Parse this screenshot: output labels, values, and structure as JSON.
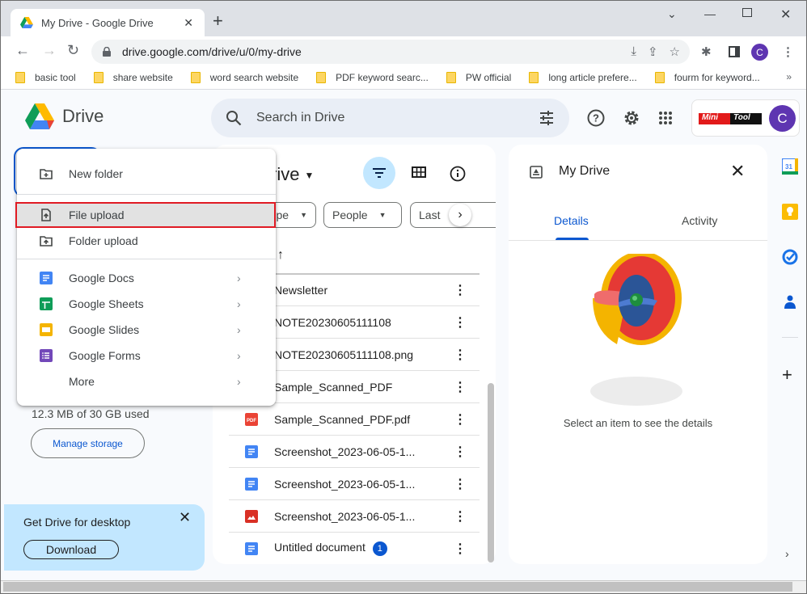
{
  "browser": {
    "tab_title": "My Drive - Google Drive",
    "url": "drive.google.com/drive/u/0/my-drive",
    "profile_initial": "C",
    "bookmarks": [
      {
        "label": "basic tool"
      },
      {
        "label": "share website"
      },
      {
        "label": "word search website"
      },
      {
        "label": "PDF keyword searc..."
      },
      {
        "label": "PW official"
      },
      {
        "label": "long article prefere..."
      },
      {
        "label": "fourm for keyword..."
      }
    ],
    "bookmarks_overflow": "»"
  },
  "header": {
    "app_name": "Drive",
    "search_placeholder": "Search in Drive",
    "account_brand_left": "Mini",
    "account_brand_right": "Tool",
    "account_initial": "C"
  },
  "new_menu": {
    "items": [
      {
        "label": "New folder",
        "icon": "new-folder-icon"
      },
      {
        "label": "File upload",
        "icon": "file-upload-icon",
        "highlighted": true
      },
      {
        "label": "Folder upload",
        "icon": "folder-upload-icon"
      },
      {
        "label": "Google Docs",
        "icon": "google-docs-icon",
        "submenu": true
      },
      {
        "label": "Google Sheets",
        "icon": "google-sheets-icon",
        "submenu": true
      },
      {
        "label": "Google Slides",
        "icon": "google-slides-icon",
        "submenu": true
      },
      {
        "label": "Google Forms",
        "icon": "google-forms-icon",
        "submenu": true
      },
      {
        "label": "More",
        "submenu": true
      }
    ],
    "chevron": "›"
  },
  "sidebar": {
    "storage_text": "12.3 MB of 30 GB used",
    "manage_storage_label": "Manage storage",
    "promo": {
      "title": "Get Drive for desktop",
      "button_label": "Download"
    }
  },
  "main": {
    "title_visible": "rive",
    "chips": [
      {
        "label": "pe"
      },
      {
        "label": "People"
      },
      {
        "label": "Last"
      }
    ],
    "sort_arrow": "↑",
    "files": [
      {
        "name": "Newsletter",
        "type": "none"
      },
      {
        "name": "NOTE20230605111108",
        "type": "none"
      },
      {
        "name": "NOTE20230605111108.png",
        "type": "none"
      },
      {
        "name": "Sample_Scanned_PDF",
        "type": "none"
      },
      {
        "name": "Sample_Scanned_PDF.pdf",
        "type": "pdf"
      },
      {
        "name": "Screenshot_2023-06-05-1...",
        "type": "doc"
      },
      {
        "name": "Screenshot_2023-06-05-1...",
        "type": "doc"
      },
      {
        "name": "Screenshot_2023-06-05-1...",
        "type": "image"
      },
      {
        "name": "Untitled document",
        "type": "doc",
        "badge": "1"
      }
    ],
    "row_menu_glyph": "⋮"
  },
  "details": {
    "title": "My Drive",
    "tabs": [
      {
        "label": "Details",
        "active": true
      },
      {
        "label": "Activity",
        "active": false
      }
    ],
    "empty_message": "Select an item to see the details"
  },
  "colors": {
    "accent": "#0b57d0",
    "highlight_outline": "#e01b24",
    "filter_active_bg": "#c2e7ff",
    "avatar": "#5e35b1"
  }
}
